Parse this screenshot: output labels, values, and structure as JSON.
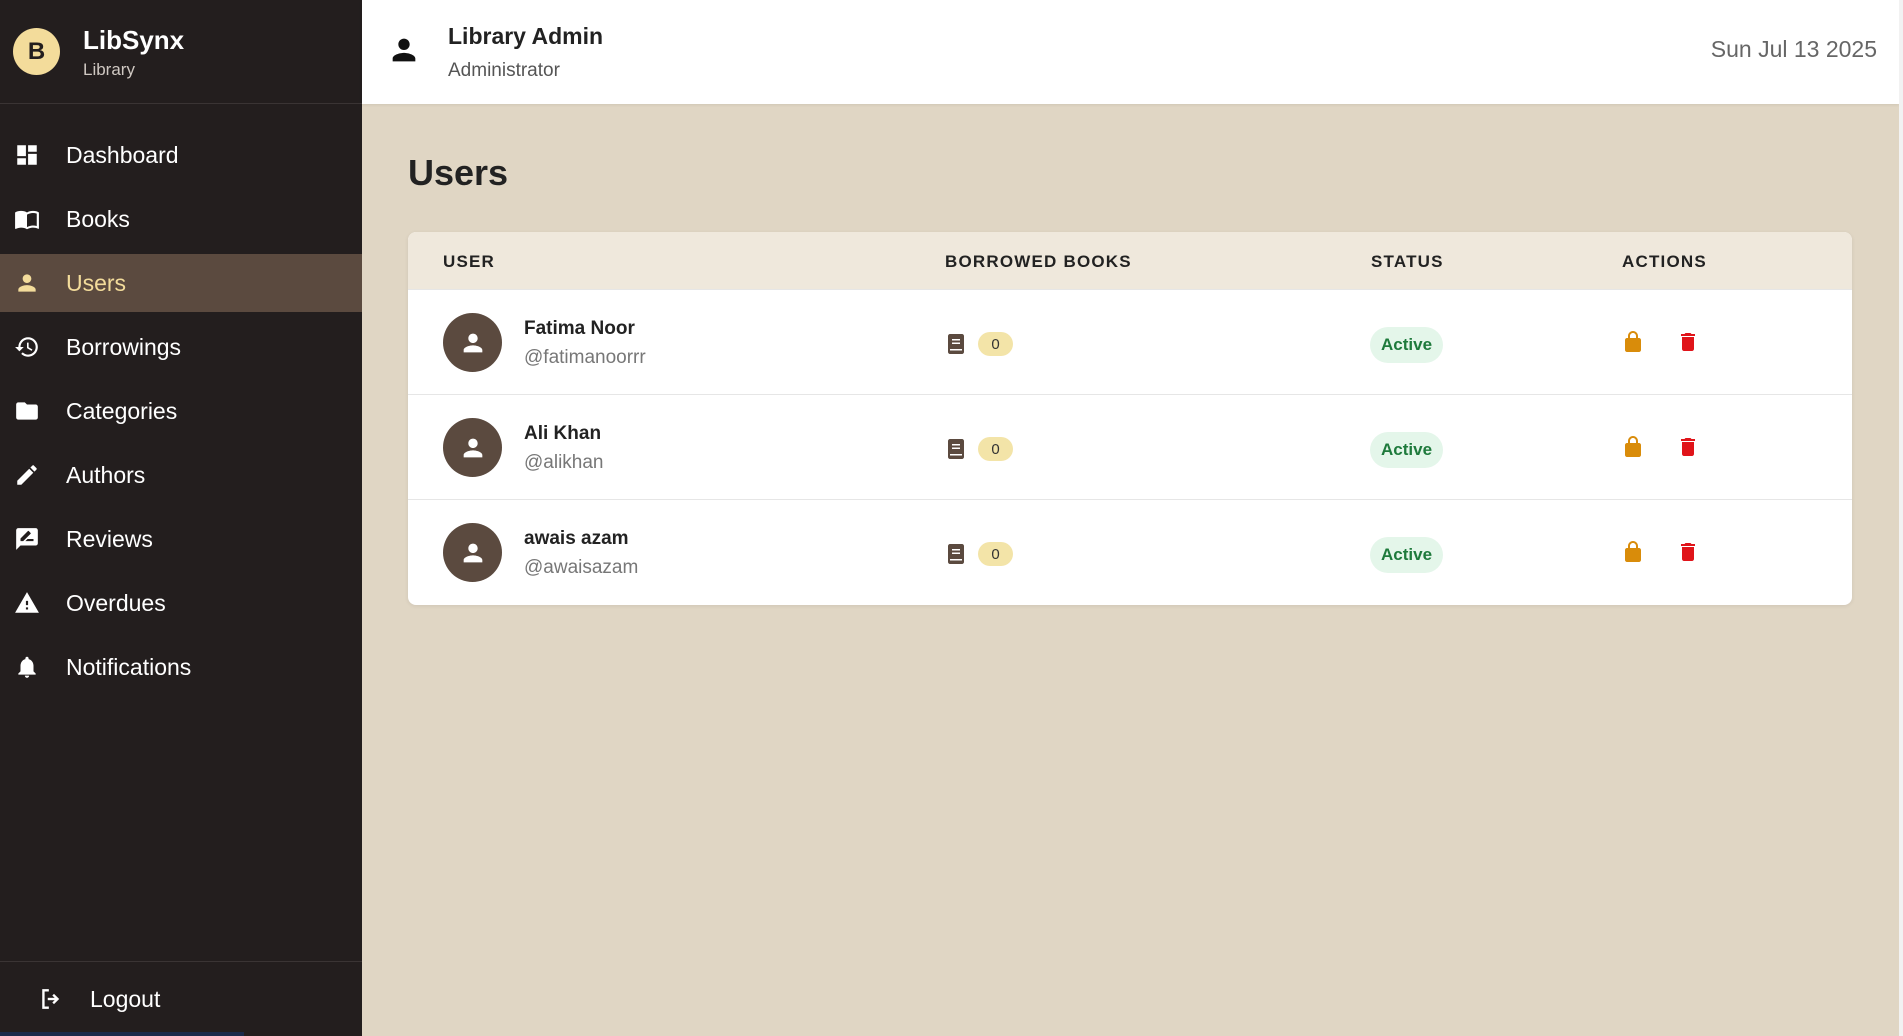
{
  "brand": {
    "initial": "B",
    "name": "LibSynx",
    "subtitle": "Library"
  },
  "sidebar": {
    "items": [
      {
        "label": "Dashboard",
        "icon": "dashboard-icon"
      },
      {
        "label": "Books",
        "icon": "book-open-icon"
      },
      {
        "label": "Users",
        "icon": "user-icon",
        "active": true
      },
      {
        "label": "Borrowings",
        "icon": "history-icon"
      },
      {
        "label": "Categories",
        "icon": "folder-icon"
      },
      {
        "label": "Authors",
        "icon": "pencil-icon"
      },
      {
        "label": "Reviews",
        "icon": "rate-review-icon"
      },
      {
        "label": "Overdues",
        "icon": "warning-icon"
      },
      {
        "label": "Notifications",
        "icon": "bell-icon"
      }
    ],
    "logout_label": "Logout"
  },
  "header": {
    "user_name": "Library Admin",
    "user_role": "Administrator",
    "date": "Sun Jul 13 2025"
  },
  "main": {
    "title": "Users",
    "table": {
      "columns": [
        "USER",
        "BORROWED BOOKS",
        "STATUS",
        "ACTIONS"
      ],
      "rows": [
        {
          "name": "Fatima Noor",
          "handle": "@fatimanoorrr",
          "borrowed": "0",
          "status": "Active"
        },
        {
          "name": "Ali Khan",
          "handle": "@alikhan",
          "borrowed": "0",
          "status": "Active"
        },
        {
          "name": "awais azam",
          "handle": "@awaisazam",
          "borrowed": "0",
          "status": "Active"
        }
      ]
    }
  },
  "colors": {
    "sidebar_bg": "#231e1e",
    "active_bg": "#5b4a3f",
    "accent": "#f3dc9b",
    "page_bg": "#e0d6c4",
    "status_active": "#1e7a3c",
    "lock": "#d98c0a",
    "delete": "#e0141a"
  }
}
